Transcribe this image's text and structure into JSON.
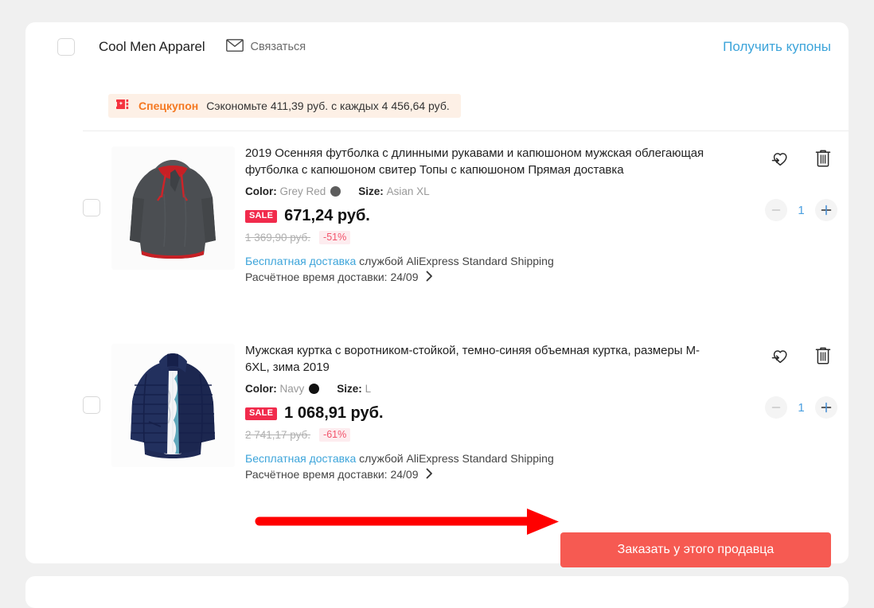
{
  "store": {
    "name": "Cool Men Apparel",
    "contact_label": "Связаться",
    "contact_icon": "envelope-icon",
    "get_coupons_label": "Получить купоны",
    "link_color": "#3ca4da"
  },
  "coupon": {
    "icon": "coupon-ticket-icon",
    "kind": "Спецкупон",
    "description": "Сэкономьте 411,39 руб. с каждых 4 456,64 руб.",
    "accent_color": "#f47821",
    "background_color": "#fdf0e6"
  },
  "products": [
    {
      "title": "2019 Осенняя футболка с длинными рукавами и капюшоном мужская облегающая футболка с капюшоном свитер Топы с капюшоном Прямая доставка",
      "color_label": "Color:",
      "color_value": "Grey Red",
      "color_swatch": "#5d5d5d",
      "size_label": "Size:",
      "size_value": "Asian XL",
      "sale_badge": "SALE",
      "price_now": "671,24 руб.",
      "price_old": "1 369,90 руб.",
      "discount": "-51%",
      "shipping_free": "Бесплатная доставка",
      "shipping_rest": "службой AliExpress Standard Shipping",
      "eta": "Расчётное время доставки: 24/09",
      "quantity": "1",
      "wishlist_icon": "heart-move-icon",
      "delete_icon": "trash-icon"
    },
    {
      "title": "Мужская куртка с воротником-стойкой, темно-синяя объемная куртка, размеры M-6XL, зима 2019",
      "color_label": "Color:",
      "color_value": "Navy",
      "color_swatch": "#111111",
      "size_label": "Size:",
      "size_value": "L",
      "sale_badge": "SALE",
      "price_now": "1 068,91 руб.",
      "price_old": "2 741,17 руб.",
      "discount": "-61%",
      "shipping_free": "Бесплатная доставка",
      "shipping_rest": "службой AliExpress Standard Shipping",
      "eta": "Расчётное время доставки: 24/09",
      "quantity": "1",
      "wishlist_icon": "heart-move-icon",
      "delete_icon": "trash-icon"
    }
  ],
  "footer": {
    "order_button_label": "Заказать у этого продавца",
    "order_button_color": "#f65a52",
    "annotation_arrow_color": "#ff0000"
  }
}
